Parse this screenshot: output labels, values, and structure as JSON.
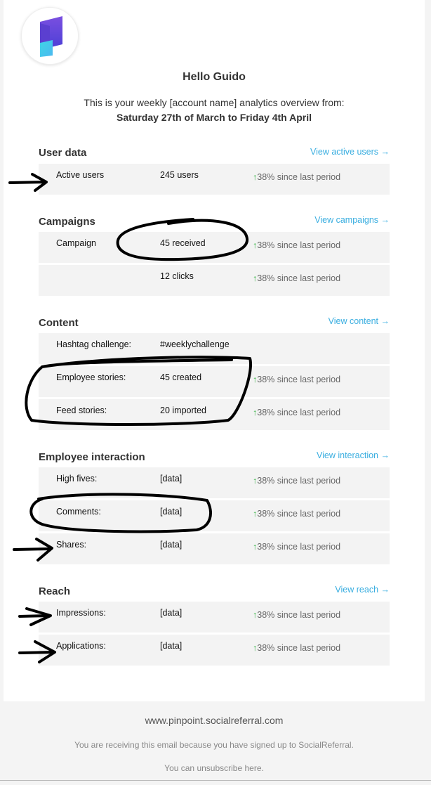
{
  "header": {
    "greeting": "Hello Guido",
    "intro_line": "This is your weekly [account name] analytics overview from:",
    "date_range": "Saturday 27th of March to Friday 4th April"
  },
  "sections": {
    "user_data": {
      "title": "User data",
      "link": "View active users →",
      "rows": [
        {
          "label": "Active users",
          "value": "245 users",
          "change": "38% since last period"
        }
      ]
    },
    "campaigns": {
      "title": "Campaigns",
      "link": "View campaigns →",
      "rows": [
        {
          "label": "Campaign",
          "value": "45 received",
          "change": "38% since last period"
        },
        {
          "label": "",
          "value": "12 clicks",
          "change": "38% since last period"
        }
      ]
    },
    "content": {
      "title": "Content",
      "link": "View content →",
      "rows": [
        {
          "label": "Hashtag challenge:",
          "value": "#weeklychallenge",
          "change": ""
        },
        {
          "label": "Employee stories:",
          "value": "45 created",
          "change": "38% since last period"
        },
        {
          "label": "Feed stories:",
          "value": "20 imported",
          "change": "38% since last period"
        }
      ]
    },
    "interaction": {
      "title": "Employee interaction",
      "link": "View interaction →",
      "rows": [
        {
          "label": "High fives:",
          "value": "[data]",
          "change": "38% since last period"
        },
        {
          "label": "Comments:",
          "value": "[data]",
          "change": "38% since last period"
        },
        {
          "label": "Shares:",
          "value": "[data]",
          "change": "38% since last period"
        }
      ]
    },
    "reach": {
      "title": "Reach",
      "link": "View reach →",
      "rows": [
        {
          "label": "Impressions:",
          "value": "[data]",
          "change": "38% since last period"
        },
        {
          "label": "Applications:",
          "value": "[data]",
          "change": "38% since last period"
        }
      ]
    }
  },
  "trend_arrow": "↑",
  "footer": {
    "site": "www.pinpoint.socialreferral.com",
    "notice": "You are receiving this email because you have signed up to SocialReferral.",
    "unsubscribe": "You can unsubscribe here."
  },
  "colors": {
    "link": "#3aaee0",
    "trend_up": "#3cb54a",
    "row_bg": "#f3f3f3"
  }
}
